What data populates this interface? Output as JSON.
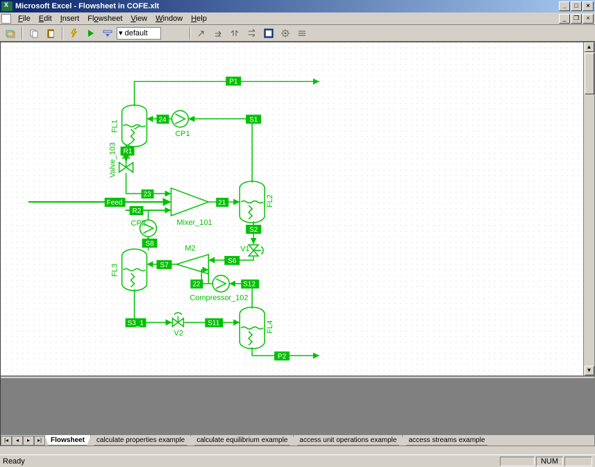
{
  "title": "Microsoft Excel - Flowsheet in COFE.xlt",
  "menu": {
    "file": "File",
    "edit": "Edit",
    "insert": "Insert",
    "flowsheet": "Flowsheet",
    "view": "View",
    "window": "Window",
    "help": "Help"
  },
  "toolbar": {
    "combo_value": "default"
  },
  "tabs": {
    "t1": "Flowsheet",
    "t2": "calculate properties example",
    "t3": "calculate equilibrium example",
    "t4": "access unit operations example",
    "t5": "access streams example"
  },
  "status": {
    "ready": "Ready",
    "num": "NUM"
  },
  "diagram": {
    "units": {
      "fl1": "FL1",
      "fl2": "FL2",
      "fl3": "FL3",
      "fl4": "FL4",
      "cp1": "CP1",
      "cp2": "CP2",
      "mixer": "Mixer_101",
      "m2": "M2",
      "comp": "Compressor_102",
      "valve103": "Valve_103",
      "v1": "V1",
      "v2": "V2"
    },
    "streams": {
      "feed": "Feed",
      "p1": "P1",
      "p2": "P2",
      "s1": "S1",
      "s2": "S2",
      "s6": "S6",
      "s7": "S7",
      "s8": "S8",
      "s11": "S11",
      "s12": "S12",
      "s3_1": "S3_1",
      "r1": "R1",
      "r2": "R2",
      "n21": "21",
      "n22": "22",
      "n23": "23",
      "n24": "24"
    }
  }
}
